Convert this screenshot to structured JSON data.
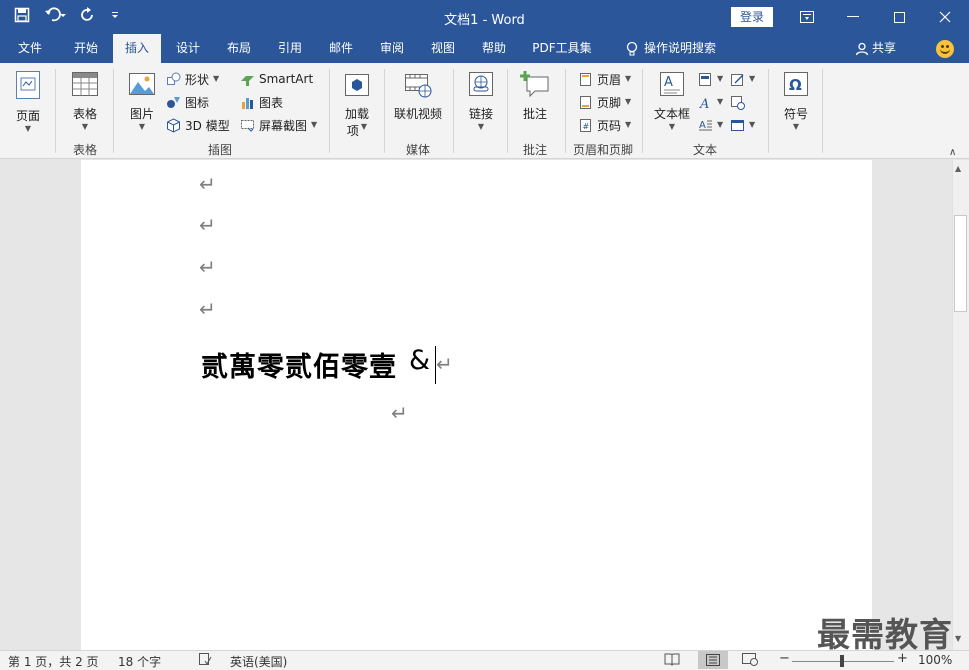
{
  "window": {
    "title": "文档1  -  Word",
    "login_label": "登录"
  },
  "tabs": [
    "文件",
    "开始",
    "插入",
    "设计",
    "布局",
    "引用",
    "邮件",
    "审阅",
    "视图",
    "帮助",
    "PDF工具集",
    "操作说明搜索"
  ],
  "active_tab": "插入",
  "share_label": "共享",
  "ribbon": {
    "page_label": "页面",
    "table_label": "表格",
    "table_group": "表格",
    "picture_label": "图片",
    "shapes_label": "形状",
    "icons_label": "图标",
    "model3d_label": "3D 模型",
    "smartart_label": "SmartArt",
    "chart_label": "图表",
    "screenshot_label": "屏幕截图",
    "illustrations_group": "插图",
    "addins_label_line1": "加载",
    "addins_label_line2": "项",
    "online_video_label": "联机视频",
    "media_group": "媒体",
    "link_label": "链接",
    "comment_label": "批注",
    "comment_group": "批注",
    "header_label": "页眉",
    "footer_label": "页脚",
    "pagenum_label": "页码",
    "headerfooter_group": "页眉和页脚",
    "textbox_label": "文本框",
    "text_group": "文本",
    "symbol_label": "符号"
  },
  "document": {
    "para_mark": "↵",
    "main_text": "贰萬零贰佰零壹",
    "ampersand": "&"
  },
  "watermark": "最需教育",
  "status": {
    "page": "第 1 页，共 2 页",
    "words": "18 个字",
    "language": "英语(美国)",
    "zoom": "100%",
    "minus": "−",
    "plus": "+"
  }
}
